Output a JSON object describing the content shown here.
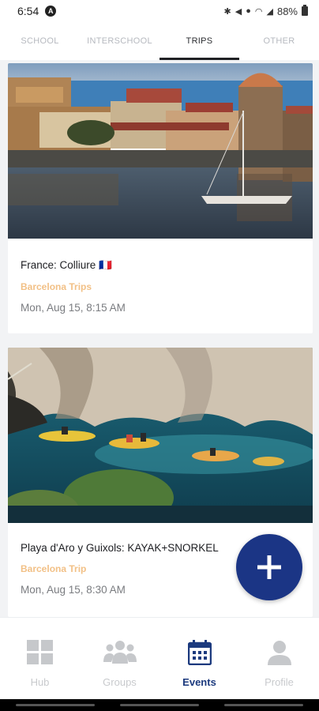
{
  "status_bar": {
    "time": "6:54",
    "a_badge": "A",
    "battery": "88%"
  },
  "tabs": [
    {
      "label": "SCHOOL",
      "active": false
    },
    {
      "label": "INTERSCHOOL",
      "active": false
    },
    {
      "label": "TRIPS",
      "active": true
    },
    {
      "label": "OTHER",
      "active": false
    }
  ],
  "events": [
    {
      "title": "France: Colliure 🇫🇷",
      "organizer": "Barcelona Trips",
      "date": "Mon, Aug 15, 8:15 AM"
    },
    {
      "title": "Playa d'Aro y Guixols: KAYAK+SNORKEL",
      "organizer": "Barcelona Trip",
      "date": "Mon, Aug 15, 8:30 AM"
    }
  ],
  "fab": {
    "icon": "plus-icon"
  },
  "bottom_nav": [
    {
      "label": "Hub",
      "icon": "grid-icon",
      "active": false
    },
    {
      "label": "Groups",
      "icon": "people-icon",
      "active": false
    },
    {
      "label": "Events",
      "icon": "calendar-icon",
      "active": true
    },
    {
      "label": "Profile",
      "icon": "person-icon",
      "active": false
    }
  ],
  "colors": {
    "accent": "#1b3585",
    "nav_active": "#1c3a7e",
    "organizer": "#f2c086"
  }
}
